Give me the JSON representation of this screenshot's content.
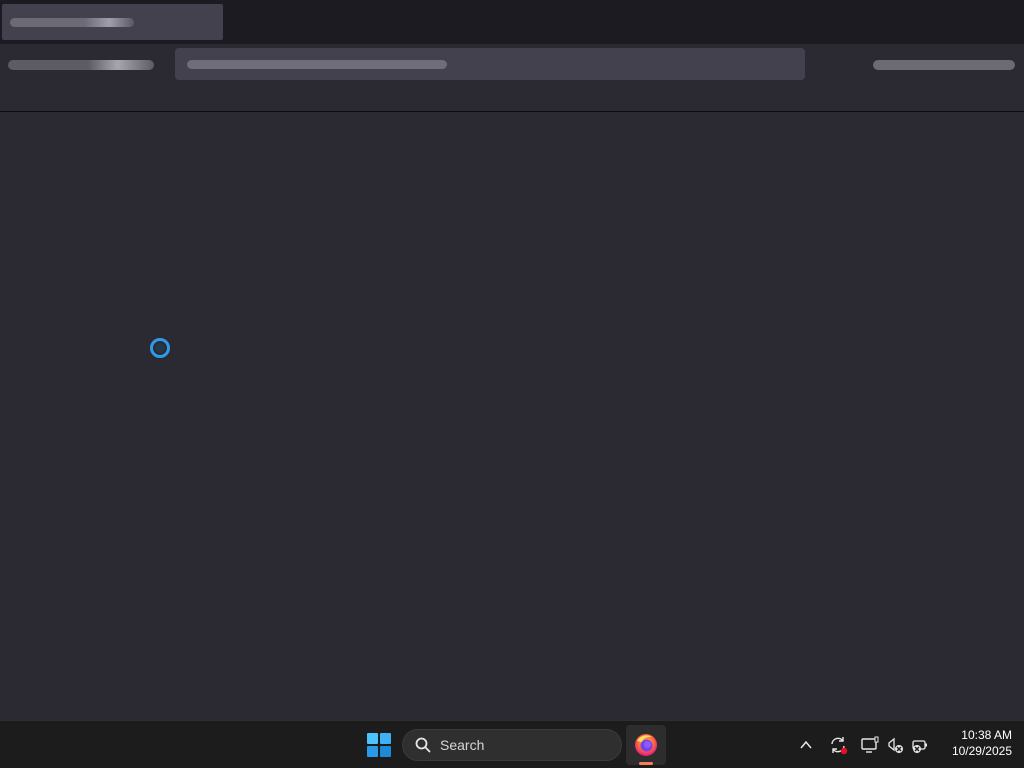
{
  "taskbar": {
    "search_label": "Search",
    "time": "10:38 AM",
    "date": "10/29/2025",
    "icons": {
      "start": "windows-logo-icon",
      "search": "search-icon",
      "browser": "firefox-icon",
      "tray_chevron": "chevron-up-icon",
      "sync": "sync-icon",
      "display": "display-icon",
      "network": "network-disconnected-icon",
      "volume": "volume-muted-icon"
    }
  },
  "content": {
    "loading_indicator": "loading-spinner-icon"
  },
  "colors": {
    "accent": "#2e9bea",
    "browser_active": "#f77d5b",
    "background": "#2b2a33"
  }
}
